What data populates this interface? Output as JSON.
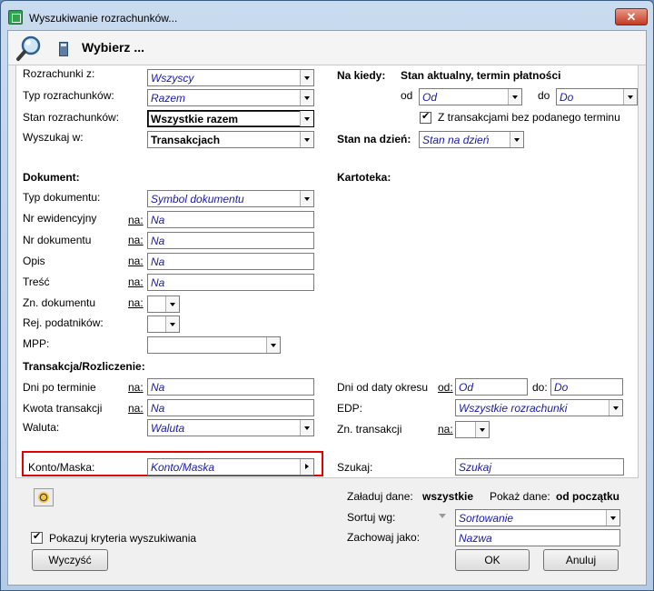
{
  "window": {
    "title": "Wyszukiwanie rozrachunków...",
    "close_label": "✕"
  },
  "header": {
    "title": "Wybierz ..."
  },
  "left": {
    "rozrachunki_z": {
      "label": "Rozrachunki z:",
      "value": "Wszyscy"
    },
    "typ_rozrachunkow": {
      "label": "Typ rozrachunków:",
      "value": "Razem"
    },
    "stan_rozrachunkow": {
      "label": "Stan rozrachunków:",
      "value": "Wszystkie razem"
    },
    "wyszukaj_w": {
      "label": "Wyszukaj w:",
      "value": "Transakcjach"
    },
    "dokument_heading": "Dokument:",
    "typ_dokumentu": {
      "label": "Typ dokumentu:",
      "value": "Symbol dokumentu"
    },
    "nr_ewidencyjny": {
      "label": "Nr ewidencyjny",
      "na": "na:",
      "value": "Na"
    },
    "nr_dokumentu": {
      "label": "Nr dokumentu",
      "na": "na:",
      "value": "Na"
    },
    "opis": {
      "label": "Opis",
      "na": "na:",
      "value": "Na"
    },
    "tresc": {
      "label": "Treść",
      "na": "na:",
      "value": "Na"
    },
    "zn_dokumentu": {
      "label": "Zn. dokumentu",
      "na": "na:"
    },
    "rej_podatnikow": {
      "label": "Rej. podatników:"
    },
    "mpp": {
      "label": "MPP:"
    },
    "transakcja_heading": "Transakcja/Rozliczenie:",
    "dni_po_terminie": {
      "label": "Dni po terminie",
      "na": "na:",
      "value": "Na"
    },
    "kwota_transakcji": {
      "label": "Kwota transakcji",
      "na": "na:",
      "value": "Na"
    },
    "waluta": {
      "label": "Waluta:",
      "value": "Waluta"
    },
    "konto_maska": {
      "label": "Konto/Maska:",
      "value": "Konto/Maska"
    }
  },
  "right": {
    "na_kiedy": {
      "label": "Na kiedy:",
      "value": "Stan aktualny, termin płatności"
    },
    "od": {
      "label": "od",
      "value": "Od"
    },
    "do": {
      "label": "do",
      "value": "Do"
    },
    "z_transakcjami": {
      "label": "Z transakcjami bez podanego terminu",
      "checked": true
    },
    "stan_na_dzien": {
      "label": "Stan na dzień:",
      "value": "Stan na dzień"
    },
    "kartoteka_heading": "Kartoteka:",
    "dni_od_daty": {
      "label": "Dni od daty okresu",
      "od_label": "od:",
      "od_value": "Od",
      "do_label": "do:",
      "do_value": "Do"
    },
    "edp": {
      "label": "EDP:",
      "value": "Wszystkie rozrachunki"
    },
    "zn_transakcji": {
      "label": "Zn. transakcji",
      "na": "na:"
    },
    "szukaj": {
      "label": "Szukaj:",
      "value": "Szukaj"
    }
  },
  "bottom": {
    "zaladuj_label": "Załaduj dane:",
    "zaladuj_value": "wszystkie",
    "pokaz_label": "Pokaż dane:",
    "pokaz_value": "od początku",
    "sortuj": {
      "label": "Sortuj wg:",
      "value": "Sortowanie"
    },
    "zachowaj": {
      "label": "Zachowaj jako:",
      "value": "Nazwa"
    },
    "pokazuj_kryteria": {
      "label": "Pokazuj kryteria wyszukiwania",
      "checked": true
    },
    "wyczysc": "Wyczyść",
    "ok": "OK",
    "anuluj": "Anuluj"
  }
}
